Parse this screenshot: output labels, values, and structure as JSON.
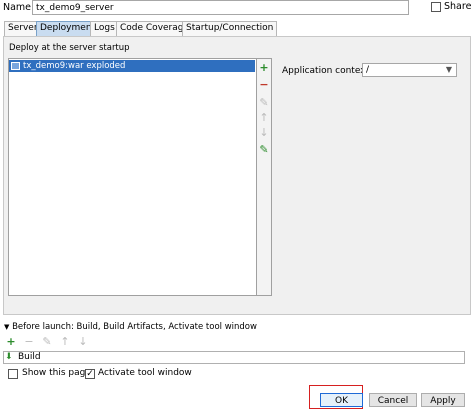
{
  "header": {
    "name_label": "Name:",
    "name_value": "tx_demo9_server",
    "share_label": "Share"
  },
  "tabs": [
    {
      "label": "Server"
    },
    {
      "label": "Deployment",
      "active": true
    },
    {
      "label": "Logs"
    },
    {
      "label": "Code Coverage"
    },
    {
      "label": "Startup/Connection"
    }
  ],
  "deployment": {
    "caption": "Deploy at the server startup",
    "artifact": "tx_demo9:war exploded",
    "context_label": "Application context:",
    "context_value": "/"
  },
  "before_launch": {
    "title": "Before launch: Build, Build Artifacts, Activate tool window",
    "task": "Build",
    "show_page_label": "Show this page",
    "activate_label": "Activate tool window",
    "activate_checked": true
  },
  "buttons": {
    "ok": "OK",
    "cancel": "Cancel",
    "apply": "Apply"
  },
  "colors": {
    "selection": "#2f6fbf",
    "add_green": "#2c8c2c",
    "remove_red": "#c0392b",
    "highlight_outline": "#d62020"
  }
}
